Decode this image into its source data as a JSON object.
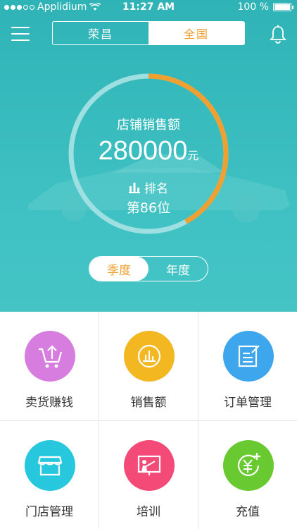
{
  "status_bar": {
    "carrier": "Applidium",
    "time": "11:27 AM",
    "battery": "100 %"
  },
  "nav": {
    "segment_left": "荣昌",
    "segment_right": "全国",
    "active_segment": "全国"
  },
  "summary": {
    "title": "店铺销售额",
    "amount": "280000",
    "unit": "元",
    "rank_label": "排名",
    "rank_value": "第86位",
    "progress_fraction": 0.42
  },
  "period_toggle": {
    "option_quarter": "季度",
    "option_year": "年度",
    "active": "季度"
  },
  "menu": [
    {
      "label": "卖货赚钱",
      "icon": "cart-upload-icon",
      "color": "#d77de0"
    },
    {
      "label": "销售额",
      "icon": "bar-chart-icon",
      "color": "#f2b721"
    },
    {
      "label": "订单管理",
      "icon": "order-edit-icon",
      "color": "#3ea6ec"
    },
    {
      "label": "门店管理",
      "icon": "storefront-icon",
      "color": "#27c8dd"
    },
    {
      "label": "培训",
      "icon": "training-board-icon",
      "color": "#f44a78"
    },
    {
      "label": "充值",
      "icon": "yuan-plus-icon",
      "color": "#69c931"
    }
  ],
  "colors": {
    "accent": "#f0a030",
    "hero_bg": "#3ab9bc",
    "ring_track": "#9ee0e2"
  }
}
